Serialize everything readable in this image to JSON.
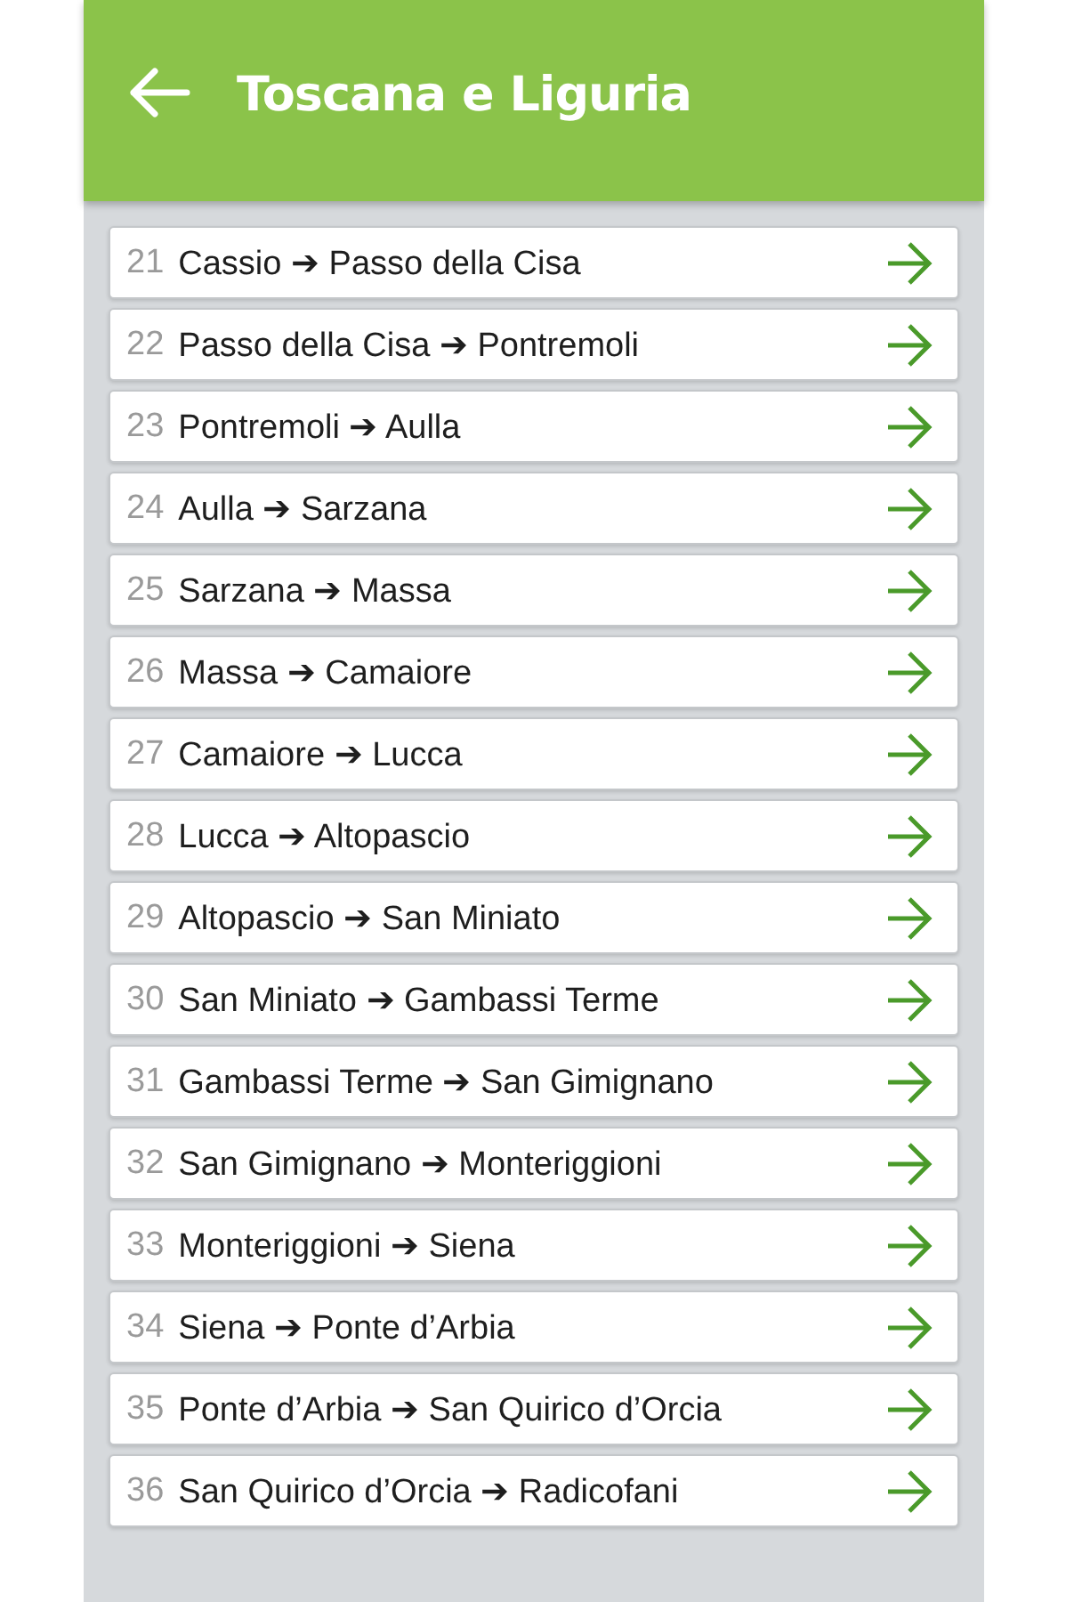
{
  "header": {
    "title": "Toscana e Liguria"
  },
  "stages": [
    {
      "number": "21",
      "route": "Cassio ➔ Passo della Cisa"
    },
    {
      "number": "22",
      "route": "Passo della Cisa ➔ Pontremoli"
    },
    {
      "number": "23",
      "route": "Pontremoli ➔ Aulla"
    },
    {
      "number": "24",
      "route": "Aulla ➔ Sarzana"
    },
    {
      "number": "25",
      "route": "Sarzana ➔ Massa"
    },
    {
      "number": "26",
      "route": "Massa ➔ Camaiore"
    },
    {
      "number": "27",
      "route": "Camaiore ➔ Lucca"
    },
    {
      "number": "28",
      "route": "Lucca ➔ Altopascio"
    },
    {
      "number": "29",
      "route": "Altopascio ➔ San Miniato"
    },
    {
      "number": "30",
      "route": "San Miniato ➔ Gambassi Terme"
    },
    {
      "number": "31",
      "route": "Gambassi Terme ➔ San Gimignano"
    },
    {
      "number": "32",
      "route": "San Gimignano ➔ Monteriggioni"
    },
    {
      "number": "33",
      "route": "Monteriggioni ➔ Siena"
    },
    {
      "number": "34",
      "route": "Siena ➔ Ponte d’Arbia"
    },
    {
      "number": "35",
      "route": "Ponte d’Arbia ➔ San Quirico d’Orcia"
    },
    {
      "number": "36",
      "route": "San Quirico d’Orcia ➔ Radicofani"
    }
  ]
}
